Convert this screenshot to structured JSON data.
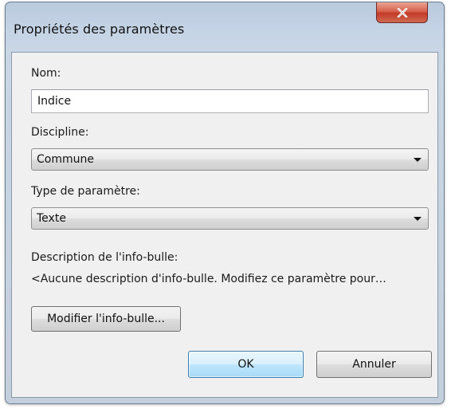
{
  "dialog": {
    "title": "Propriétés des paramètres",
    "close_icon": "close-icon"
  },
  "form": {
    "name_label": "Nom:",
    "name_value": "Indice",
    "discipline_label": "Discipline:",
    "discipline_value": "Commune",
    "param_type_label": "Type de paramètre:",
    "param_type_value": "Texte",
    "tooltip_label": "Description de l'info-bulle:",
    "tooltip_text": "<Aucune description d'info-bulle. Modifiez ce paramètre pour…",
    "edit_tooltip_button": "Modifier l'info-bulle..."
  },
  "buttons": {
    "ok": "OK",
    "cancel": "Annuler"
  },
  "colors": {
    "close_button": "#c23a27",
    "default_button_border": "#3c7fb1"
  }
}
